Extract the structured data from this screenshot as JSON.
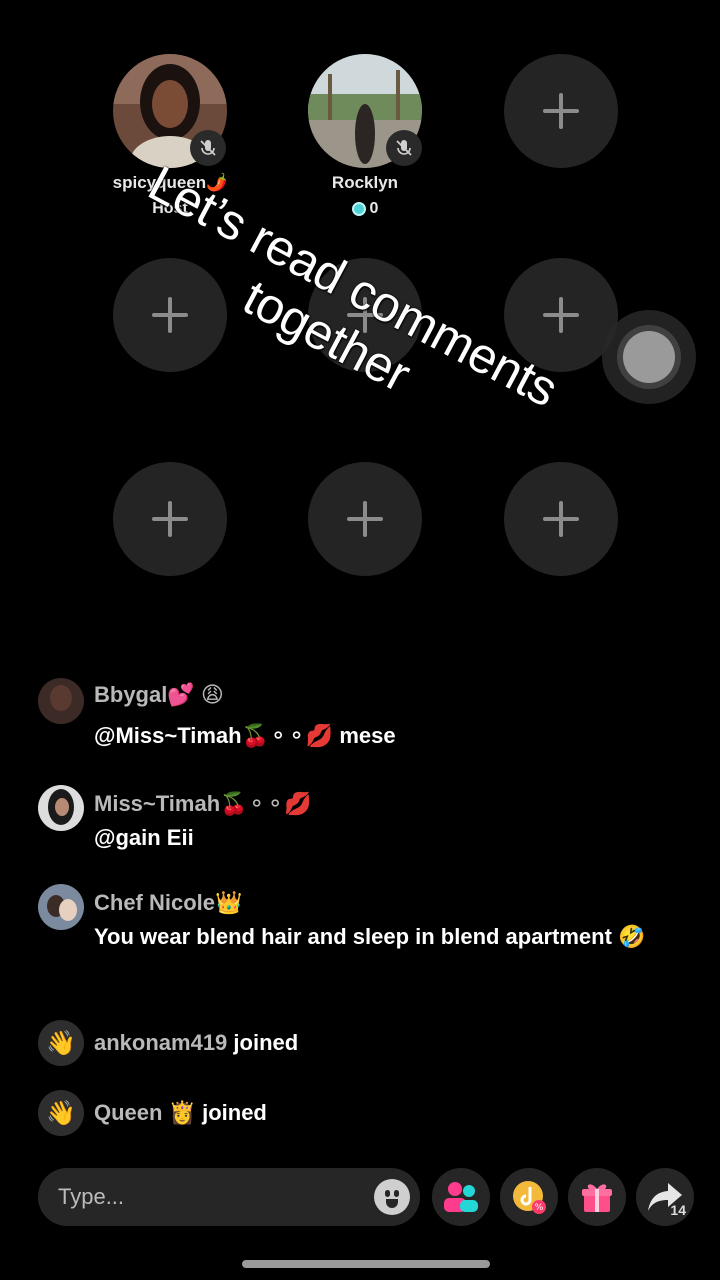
{
  "seats": {
    "host": {
      "name": "spicyqueen🌶️",
      "role": "Host"
    },
    "guest": {
      "name": "Rocklyn",
      "coins": "0"
    }
  },
  "caption": "Let’s read comments together",
  "comments": [
    {
      "user": "Bbygal💕 😩",
      "text": "@Miss~Timah🍒⚬⚬💋 mese"
    },
    {
      "user": "Miss~Timah🍒⚬⚬💋",
      "text": "@gain Eii"
    },
    {
      "user": "Chef Nicole👑",
      "text": "You wear blend hair and sleep in blend apartment 🤣"
    }
  ],
  "joins": [
    {
      "user": "ankonam419",
      "action": "joined"
    },
    {
      "user": "Queen 👸",
      "action": "joined"
    }
  ],
  "input": {
    "placeholder": "Type..."
  },
  "share": {
    "count": "14"
  },
  "icons": {
    "mute": "mic-off-icon",
    "wave": "waving-hand-icon",
    "emoji": "smiley-icon",
    "guests": "multi-guest-icon",
    "promo": "tiktok-coupon-icon",
    "gift": "gift-icon",
    "share": "share-arrow-icon"
  },
  "colors": {
    "background": "#000000",
    "seat": "#242424",
    "guests_icon": "#ff3b8d",
    "guests_accent": "#25d6d6",
    "gift": "#ff4f8b",
    "gem": "#4fd2d6"
  }
}
